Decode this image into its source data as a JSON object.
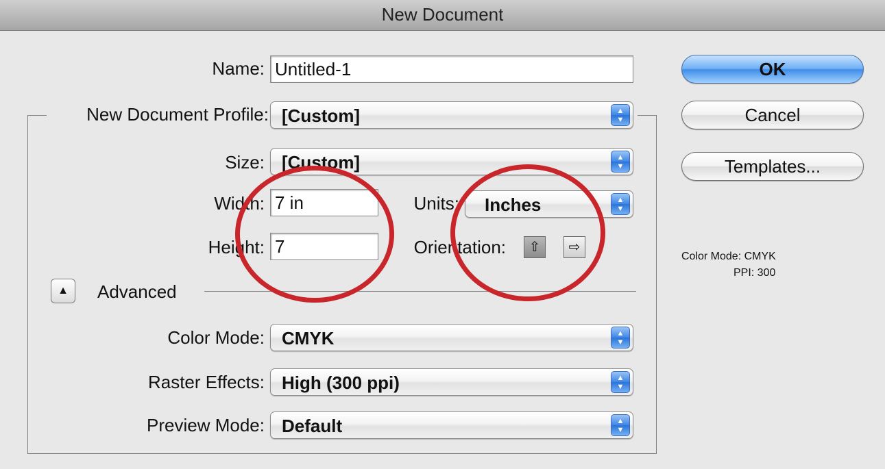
{
  "window": {
    "title": "New Document"
  },
  "form": {
    "name_label": "Name:",
    "name_value": "Untitled-1",
    "profile_label": "New Document Profile:",
    "profile_value": "[Custom]",
    "size_label": "Size:",
    "size_value": "[Custom]",
    "width_label": "Width:",
    "width_value": "7 in",
    "height_label": "Height:",
    "height_value": "7",
    "units_label": "Units:",
    "units_value": "Inches",
    "orientation_label": "Orientation:",
    "advanced_label": "Advanced",
    "color_mode_label": "Color Mode:",
    "color_mode_value": "CMYK",
    "raster_label": "Raster Effects:",
    "raster_value": "High (300 ppi)",
    "preview_label": "Preview Mode:",
    "preview_value": "Default"
  },
  "buttons": {
    "ok": "OK",
    "cancel": "Cancel",
    "templates": "Templates..."
  },
  "info": {
    "color_mode": "Color Mode: CMYK",
    "ppi": "PPI: 300"
  },
  "icons": {
    "select_arrows": "▲▼",
    "disclosure": "▲",
    "portrait": "⇧",
    "landscape": "⇨"
  },
  "colors": {
    "annotation_circle": "#c8262b",
    "primary_button": "#3f8ee9"
  }
}
